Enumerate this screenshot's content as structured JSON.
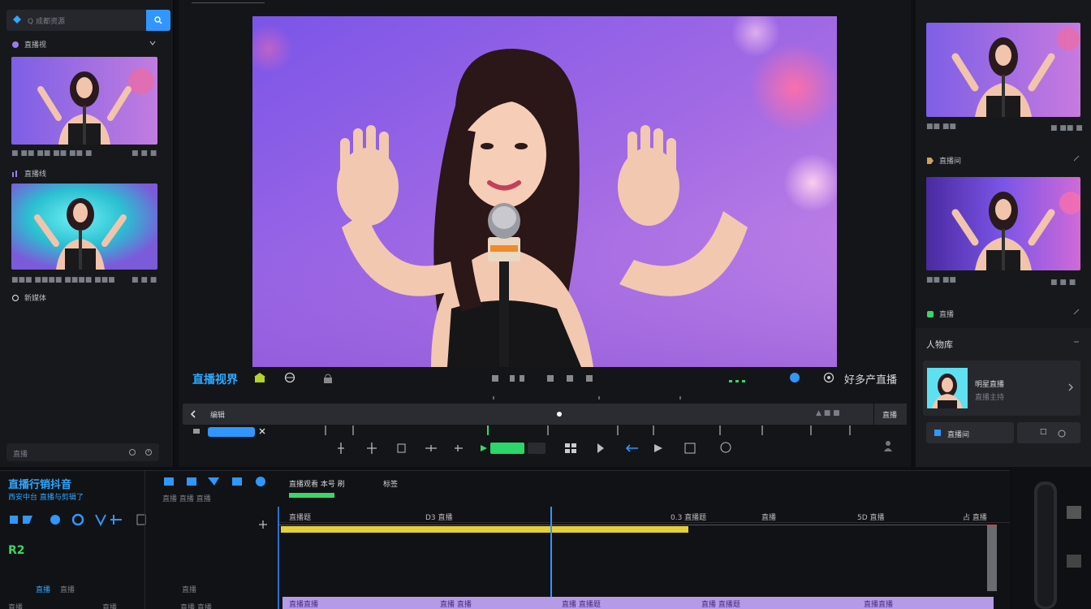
{
  "left_panel": {
    "search_text": "Q 成都资源",
    "section1_label": "直播视",
    "section2_label": "直播线",
    "section3_label": "新媒体",
    "thumb1_meta_left": "■ ■■ ■■ ■■ ■■ ■",
    "thumb1_meta_right": "■ ■ ■",
    "thumb2_meta_left": "■■■ ■■■■ ■■■■ ■■■",
    "thumb2_meta_right": "■ ■ ■",
    "footer_label": "直播",
    "colors": {
      "accent": "#2f97ff",
      "background": "#17181b"
    }
  },
  "preview": {
    "brand_label": "直播视界",
    "right_label": "好多产直播",
    "ctrl_text": "编辑",
    "ctrl_end_label": "直播",
    "zoom_hint": "▲ ■ ■"
  },
  "right_panel": {
    "thumb1_meta_left": "■■ ■■",
    "thumb1_meta_right": "■ ■■ ■",
    "section1_label": "直播间",
    "thumb2_meta_left": "■■ ■■",
    "thumb2_meta_right": "■ ■ ■",
    "section2_label": "直播",
    "header_label": "人物库",
    "card_title": "明星直播",
    "card_sub": "直播主持",
    "btn_primary": "直播间",
    "btn_icon_label": "□"
  },
  "timeline": {
    "title": "直播行销抖音",
    "subtitle": "西安中台 直播与剪辑了",
    "green_tag": "R2",
    "row_label_1": "直播",
    "row_label_2": "直播",
    "row_label_3": "直播",
    "header_label_a": "直播观看 本号 刷",
    "header_label_b": "标签",
    "header_sub": "直播 直播 直播",
    "ruler": [
      "直播题",
      "D3 直播",
      "0.3 直播题",
      "直播",
      "5D 直播",
      "占 直播"
    ],
    "clip_labels": [
      "直播直播",
      "直播 直播",
      "直播 直播题",
      "直播 直播题",
      "直播直播"
    ],
    "footer_labels": [
      "直播",
      "直播",
      "直播 直播"
    ]
  }
}
